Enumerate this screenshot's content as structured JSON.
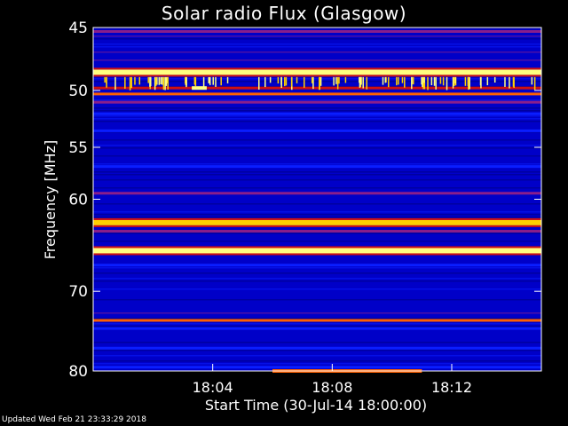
{
  "chart_data": {
    "type": "heatmap",
    "title": "Solar radio Flux (Glasgow)",
    "xlabel": "Start Time (30-Jul-14 18:00:00)",
    "ylabel": "Frequency [MHz]",
    "x_unit": "minutes after start time",
    "xlim": [
      0,
      15
    ],
    "ylim": [
      80,
      45
    ],
    "y_scale": "log",
    "x_ticks": [
      {
        "value": 4,
        "label": "18:04"
      },
      {
        "value": 8,
        "label": "18:08"
      },
      {
        "value": 12,
        "label": "18:12"
      }
    ],
    "y_ticks": [
      {
        "value": 45,
        "label": "45"
      },
      {
        "value": 50,
        "label": "50"
      },
      {
        "value": 55,
        "label": "55"
      },
      {
        "value": 60,
        "label": "60"
      },
      {
        "value": 70,
        "label": "70"
      },
      {
        "value": 80,
        "label": "80"
      }
    ],
    "colormap": [
      "#000080",
      "#0000c8",
      "#0a1eff",
      "#8a1e8a",
      "#d01010",
      "#ff6000",
      "#ffd000",
      "#ffff80"
    ],
    "background_intensity": 0.18,
    "bands": [
      {
        "freq": 45.3,
        "intensity": 0.45
      },
      {
        "freq": 48.5,
        "intensity": 0.95
      },
      {
        "freq": 49.8,
        "intensity": 0.6
      },
      {
        "freq": 50.3,
        "intensity": 0.65
      },
      {
        "freq": 51.0,
        "intensity": 0.4
      },
      {
        "freq": 52.0,
        "intensity": 0.32
      },
      {
        "freq": 53.5,
        "intensity": 0.3
      },
      {
        "freq": 56.8,
        "intensity": 0.35
      },
      {
        "freq": 59.4,
        "intensity": 0.4
      },
      {
        "freq": 62.4,
        "intensity": 0.9
      },
      {
        "freq": 63.3,
        "intensity": 0.45
      },
      {
        "freq": 65.4,
        "intensity": 0.95
      },
      {
        "freq": 67.0,
        "intensity": 0.3
      },
      {
        "freq": 73.5,
        "intensity": 0.7
      },
      {
        "freq": 74.5,
        "intensity": 0.28
      },
      {
        "freq": 77.0,
        "intensity": 0.25
      },
      {
        "freq": 79.5,
        "intensity": 0.3
      }
    ],
    "bursts": [
      {
        "x0": 6.0,
        "x1": 11.0,
        "freq": 80.0,
        "intensity": 0.7
      },
      {
        "x0": 3.3,
        "x1": 3.8,
        "freq": 49.8,
        "intensity": 0.95
      }
    ]
  },
  "footer": "Updated Wed Feb 21 23:33:29 2018"
}
